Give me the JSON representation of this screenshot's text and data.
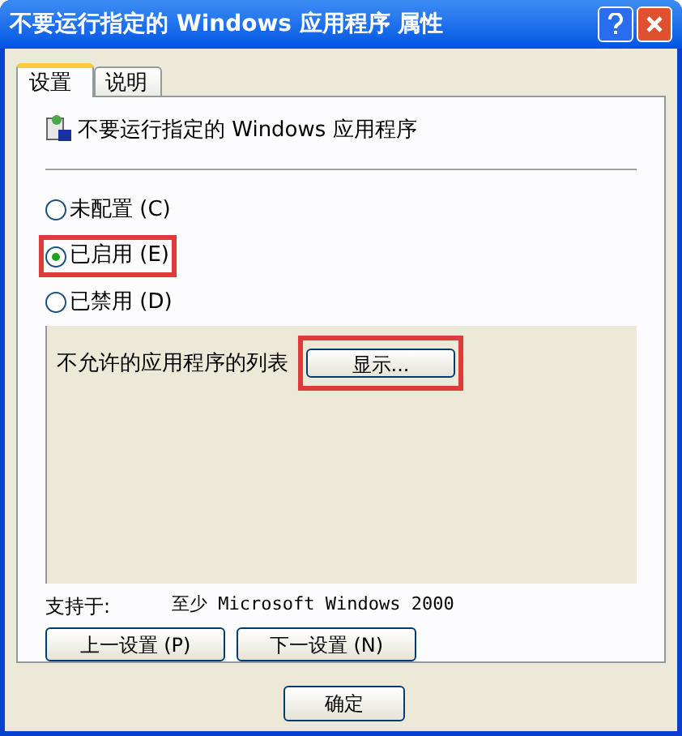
{
  "window": {
    "title": "不要运行指定的 Windows 应用程序 属性"
  },
  "tabs": [
    {
      "label": "设置",
      "selected": true
    },
    {
      "label": "说明",
      "selected": false
    }
  ],
  "policy": {
    "name": "不要运行指定的 Windows 应用程序"
  },
  "options": [
    {
      "label": "未配置 (C)",
      "selected": false,
      "highlighted": false
    },
    {
      "label": "已启用 (E)",
      "selected": true,
      "highlighted": true
    },
    {
      "label": "已禁用 (D)",
      "selected": false,
      "highlighted": false
    }
  ],
  "settings": {
    "label": "不允许的应用程序的列表",
    "button": {
      "label": "显示...",
      "highlighted": true
    }
  },
  "supported": {
    "label": "支持于:",
    "value": "至少 Microsoft Windows 2000"
  },
  "nav_buttons": [
    "上一设置 (P)",
    "下一设置 (N)"
  ],
  "dialog_buttons": [
    "确定"
  ]
}
